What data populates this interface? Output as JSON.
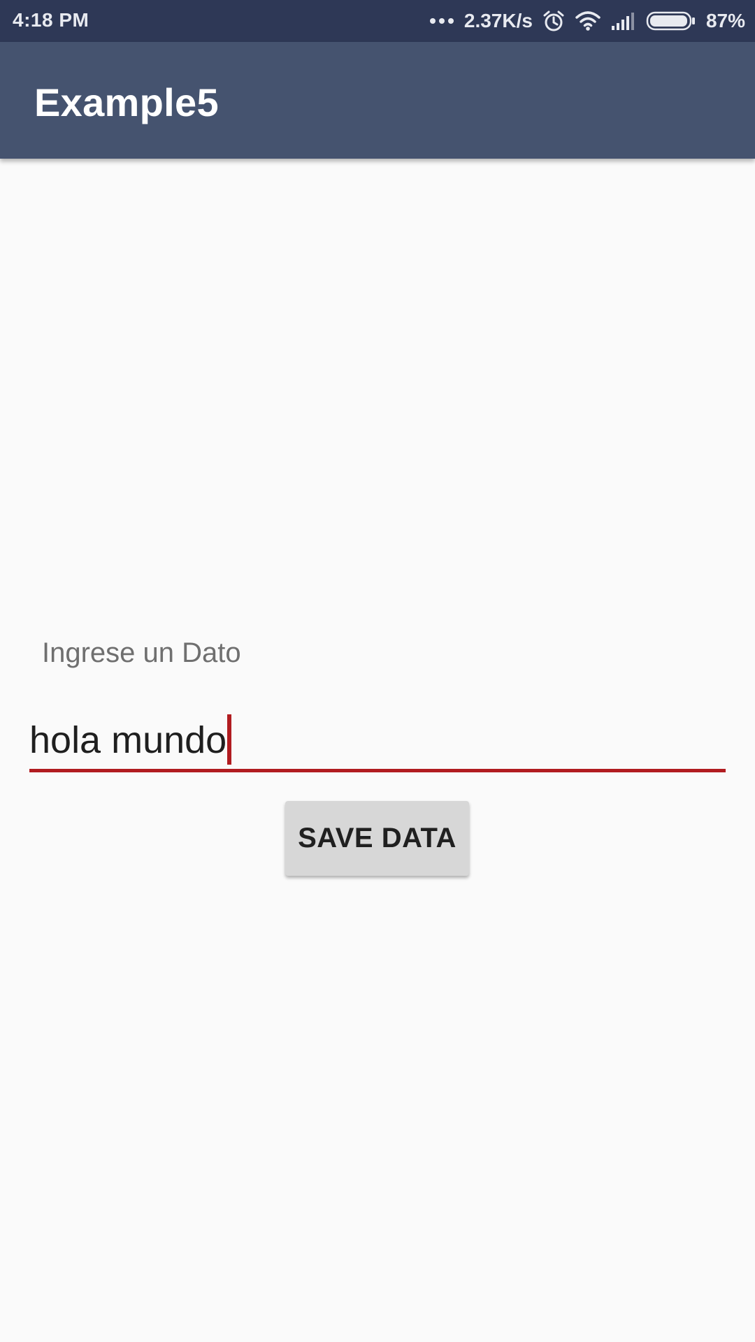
{
  "status_bar": {
    "time": "4:18 PM",
    "network_speed": "2.37K/s",
    "battery_percent": "87%",
    "battery_level": 0.87,
    "icons": [
      "more-dots-icon",
      "alarm-clock-icon",
      "wifi-icon",
      "cellular-signal-icon",
      "battery-icon"
    ]
  },
  "app_bar": {
    "title": "Example5",
    "color": "#45536f"
  },
  "form": {
    "hint_label": "Ingrese un Dato",
    "input_value": "hola mundo",
    "accent_color": "#b11c20",
    "save_button_label": "SAVE DATA"
  }
}
